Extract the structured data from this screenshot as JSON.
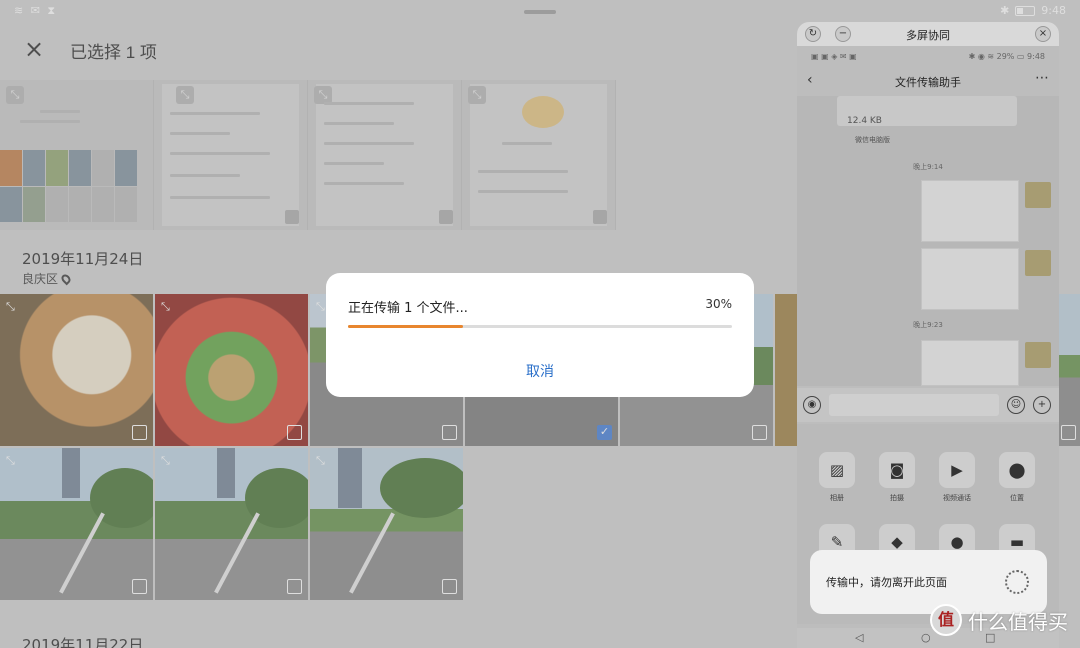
{
  "status_bar": {
    "left_icons": "≋ ✉ ⧗",
    "bluetooth": "✱",
    "time": "9:48"
  },
  "header": {
    "close_icon": "×",
    "title": "已选择 1 项"
  },
  "sections": [
    {
      "date": "2019年11月24日",
      "place": "良庆区"
    },
    {
      "date": "2019年11月22日"
    }
  ],
  "dialog": {
    "title": "正在传输 1 个文件...",
    "percent_text": "30%",
    "progress": 0.3,
    "cancel_label": "取消",
    "accent": "#e8862e",
    "link_color": "#2a6fc9"
  },
  "phone_window": {
    "title": "多屏协同",
    "status_left": "▣ ▣ ◈ ✉ ▣",
    "status_right": "✱ ◉ ≋ 29% ▭ 9:48",
    "chat_title": "文件传输助手",
    "file_size": "12.4 KB",
    "file_app": "微信电脑版",
    "time1": "晚上9:14",
    "time2": "晚上9:23",
    "apps": [
      {
        "icon": "image-icon",
        "label": "相册",
        "glyph": "▨"
      },
      {
        "icon": "camera-icon",
        "label": "拍摄",
        "glyph": "◙"
      },
      {
        "icon": "video-call-icon",
        "label": "视频通话",
        "glyph": "▶"
      },
      {
        "icon": "location-icon",
        "label": "位置",
        "glyph": "⬤"
      }
    ],
    "apps_row2_glyphs": [
      "✎",
      "◆",
      "●",
      "▬"
    ]
  },
  "toast": {
    "text": "传输中，请勿离开此页面"
  },
  "watermark": {
    "logo": "值",
    "text": "什么值得买"
  }
}
